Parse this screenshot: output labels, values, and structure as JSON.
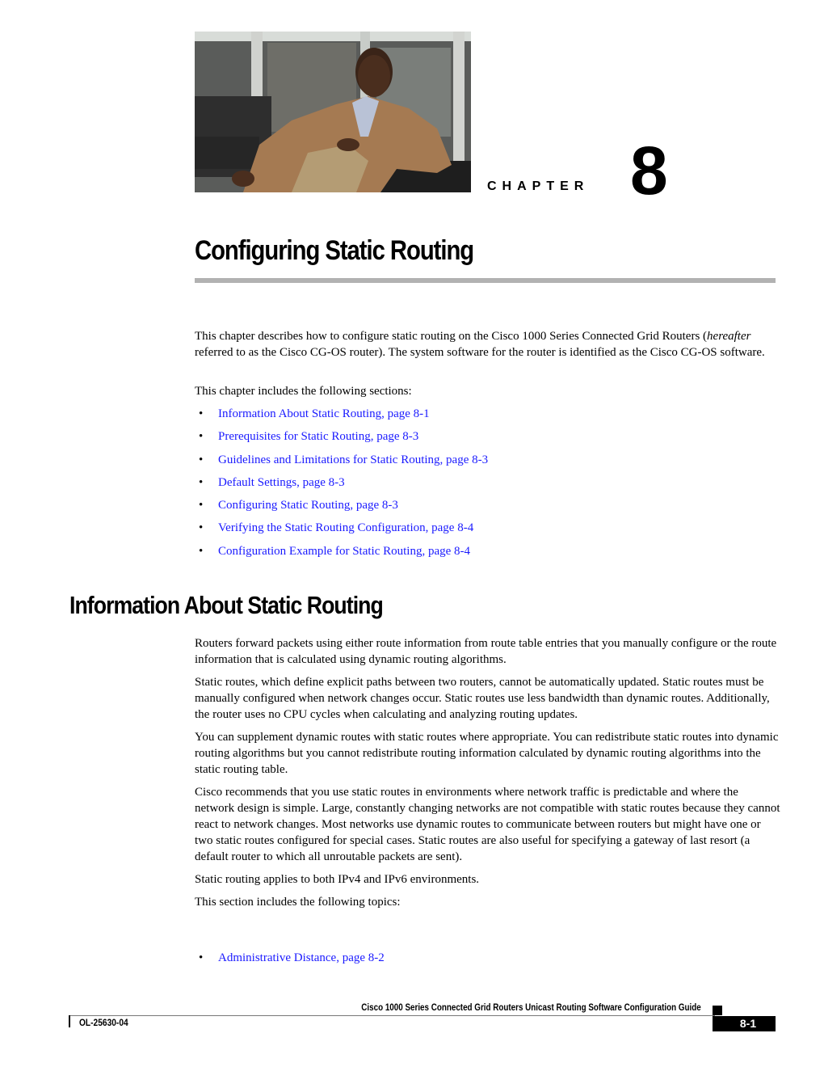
{
  "chapter": {
    "photo_alt": "man-in-tan-jacket-seated-photo",
    "label": "CHAPTER",
    "number": "8",
    "title": "Configuring Static Routing"
  },
  "intro": {
    "paragraph_parts": [
      "This chapter describes how to configure static routing on the Cisco 1000 Series Connected Grid Routers (",
      "hereafter",
      " referred to as the Cisco CG-OS router). The system software for the router is identified as the Cisco CG-OS software."
    ],
    "sections_intro": "This chapter includes the following sections:",
    "sections": [
      {
        "label": "Information About Static Routing, page 8-1"
      },
      {
        "label": "Prerequisites for Static Routing, page 8-3"
      },
      {
        "label": "Guidelines and Limitations for Static Routing, page 8-3"
      },
      {
        "label": "Default Settings, page 8-3"
      },
      {
        "label": "Configuring Static Routing, page 8-3"
      },
      {
        "label": "Verifying the Static Routing Configuration, page 8-4"
      },
      {
        "label": "Configuration Example for Static Routing, page 8-4"
      }
    ]
  },
  "info_section": {
    "heading": "Information About Static Routing",
    "paragraphs": [
      "Routers forward packets using either route information from route table entries that you manually configure or the route information that is calculated using dynamic routing algorithms.",
      "Static routes, which define explicit paths between two routers, cannot be automatically updated. Static routes must be manually configured when network changes occur. Static routes use less bandwidth than dynamic routes. Additionally, the router uses no CPU cycles when calculating and analyzing routing updates.",
      "You can supplement dynamic routes with static routes where appropriate. You can redistribute static routes into dynamic routing algorithms but you cannot redistribute routing information calculated by dynamic routing algorithms into the static routing table.",
      "Cisco recommends that you use static routes in environments where network traffic is predictable and where the network design is simple. Large, constantly changing networks are not compatible with static routes because they cannot react to network changes. Most networks use dynamic routes to communicate between routers but might have one or two static routes configured for special cases. Static routes are also useful for specifying a gateway of last resort (a default router to which all unroutable packets are sent).",
      "Static routing applies to both IPv4 and IPv6 environments.",
      "This section includes the following topics:"
    ],
    "topics": [
      {
        "label": "Administrative Distance, page 8-2"
      }
    ]
  },
  "footer": {
    "guide_title": "Cisco 1000 Series Connected Grid Routers Unicast Routing Software Configuration Guide",
    "doc_number": "OL-25630-04",
    "page_number": "8-1"
  },
  "colors": {
    "link": "#1a1aff",
    "title_rule": "#b2b2b2"
  }
}
